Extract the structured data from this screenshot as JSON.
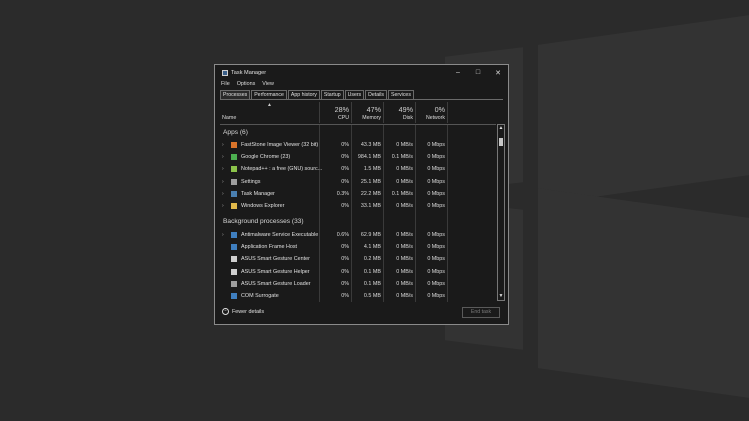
{
  "window": {
    "title": "Task Manager",
    "controls": [
      "–",
      "□",
      "✕"
    ]
  },
  "menu": [
    "File",
    "Options",
    "View"
  ],
  "tabs": [
    "Processes",
    "Performance",
    "App history",
    "Startup",
    "Users",
    "Details",
    "Services"
  ],
  "columns": {
    "name": "Name",
    "cpu": {
      "pct": "28%",
      "label": "CPU"
    },
    "memory": {
      "pct": "47%",
      "label": "Memory"
    },
    "disk": {
      "pct": "49%",
      "label": "Disk"
    },
    "network": {
      "pct": "0%",
      "label": "Network"
    }
  },
  "apps_group": "Apps (6)",
  "apps": [
    {
      "name": "FastStone Image Viewer (32 bit)",
      "cpu": "0%",
      "memory": "43.3 MB",
      "disk": "0 MB/s",
      "network": "0 Mbps",
      "icon": "faststone-icon",
      "color": "#d9742a"
    },
    {
      "name": "Google Chrome (23)",
      "cpu": "0%",
      "memory": "984.1 MB",
      "disk": "0.1 MB/s",
      "network": "0 Mbps",
      "icon": "chrome-icon",
      "color": "#4caf50"
    },
    {
      "name": "Notepad++ : a free (GNU) sourc...",
      "cpu": "0%",
      "memory": "1.5 MB",
      "disk": "0 MB/s",
      "network": "0 Mbps",
      "icon": "notepad-icon",
      "color": "#8bc34a"
    },
    {
      "name": "Settings",
      "cpu": "0%",
      "memory": "25.1 MB",
      "disk": "0 MB/s",
      "network": "0 Mbps",
      "icon": "gear-icon",
      "color": "#9e9e9e"
    },
    {
      "name": "Task Manager",
      "cpu": "0.3%",
      "memory": "22.2 MB",
      "disk": "0.1 MB/s",
      "network": "0 Mbps",
      "icon": "task-manager-icon",
      "color": "#4a7fb0"
    },
    {
      "name": "Windows Explorer",
      "cpu": "0%",
      "memory": "33.1 MB",
      "disk": "0 MB/s",
      "network": "0 Mbps",
      "icon": "folder-icon",
      "color": "#e0b84a"
    }
  ],
  "bg_group": "Background processes (33)",
  "background": [
    {
      "name": "Antimalware Service Executable",
      "cpu": "0.6%",
      "memory": "62.9 MB",
      "disk": "0 MB/s",
      "network": "0 Mbps",
      "icon": "antimalware-icon",
      "color": "#3f7fc0",
      "expandable": true
    },
    {
      "name": "Application Frame Host",
      "cpu": "0%",
      "memory": "4.1 MB",
      "disk": "0 MB/s",
      "network": "0 Mbps",
      "icon": "app-frame-icon",
      "color": "#3f7fc0",
      "expandable": false
    },
    {
      "name": "ASUS Smart Gesture Center",
      "cpu": "0%",
      "memory": "0.2 MB",
      "disk": "0 MB/s",
      "network": "0 Mbps",
      "icon": "asus-icon",
      "color": "#cfcfcf",
      "expandable": false
    },
    {
      "name": "ASUS Smart Gesture Helper",
      "cpu": "0%",
      "memory": "0.1 MB",
      "disk": "0 MB/s",
      "network": "0 Mbps",
      "icon": "asus-icon",
      "color": "#cfcfcf",
      "expandable": false
    },
    {
      "name": "ASUS Smart Gesture Loader",
      "cpu": "0%",
      "memory": "0.1 MB",
      "disk": "0 MB/s",
      "network": "0 Mbps",
      "icon": "asus-icon",
      "color": "#9e9e9e",
      "expandable": false
    },
    {
      "name": "COM Surrogate",
      "cpu": "0%",
      "memory": "0.5 MB",
      "disk": "0 MB/s",
      "network": "0 Mbps",
      "icon": "com-icon",
      "color": "#3f7fc0",
      "expandable": false
    }
  ],
  "footer": {
    "fewer": "Fewer details",
    "end_task": "End task"
  }
}
